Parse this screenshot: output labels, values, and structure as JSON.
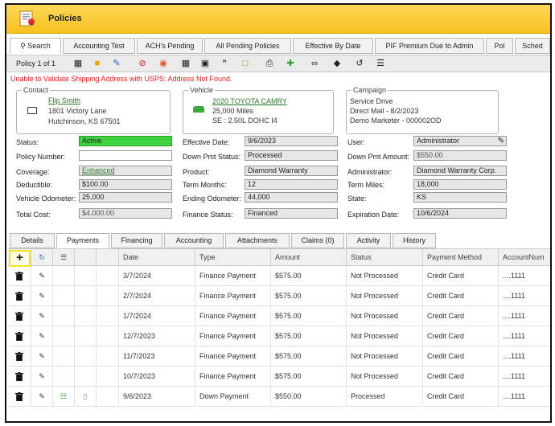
{
  "app": {
    "title": "Policies"
  },
  "top_tabs": [
    {
      "label": "Search",
      "icon": "search-icon"
    },
    {
      "label": "Accounting Test"
    },
    {
      "label": "ACH's Pending"
    },
    {
      "label": "All Pending Policies"
    },
    {
      "label": "Effective By Date"
    },
    {
      "label": "PIF Premium Due to Admin"
    },
    {
      "label": "Pol"
    },
    {
      "label": "Sched"
    }
  ],
  "toolbar": {
    "policy_count": "Policy 1 of 1",
    "icons": [
      "grid-icon",
      "folder-icon",
      "edit-doc-icon",
      "cancel-icon",
      "lifebuoy-icon",
      "calculator-icon",
      "trash-icon",
      "quote-icon",
      "document-icon",
      "printer-icon",
      "add-file-icon",
      "link-icon",
      "tag-icon",
      "history-icon",
      "list-icon"
    ]
  },
  "warning": "Unable to Validate Shipping Address with USPS: Address Not Found.",
  "contact": {
    "legend": "Contact",
    "name": "Flip Smith",
    "street": "1801 Victory Lane",
    "city": "Hutchinson, KS 67501"
  },
  "vehicle": {
    "legend": "Vehicle",
    "title": "2020 TOYOTA CAMRY",
    "miles": "25,000 Miles",
    "engine": "SE : 2.50L DOHC I4"
  },
  "campaign": {
    "legend": "Campaign",
    "name": "Service Drive",
    "mail": "Direct Mail - 8/2/2023",
    "marketer": "Demo Marketer - 000002OD"
  },
  "fields": {
    "status_label": "Status:",
    "status": "Active",
    "policy_number_label": "Policy Number:",
    "policy_number": "",
    "coverage_label": "Coverage:",
    "coverage": "Enhanced",
    "deductible_label": "Deductible:",
    "deductible": "$100.00",
    "vehicle_odometer_label": "Vehicle Odometer:",
    "vehicle_odometer": "25,000",
    "total_cost_label": "Total Cost:",
    "total_cost": "$4,000.00",
    "effective_date_label": "Effective Date:",
    "effective_date": "9/6/2023",
    "down_pmt_status_label": "Down Pmt Status:",
    "down_pmt_status": "Processed",
    "product_label": "Product:",
    "product": "Diamond Warranty",
    "term_months_label": "Term Months:",
    "term_months": "12",
    "ending_odometer_label": "Ending Odometer:",
    "ending_odometer": "44,000",
    "finance_status_label": "Finance Status:",
    "finance_status": "Financed",
    "user_label": "User:",
    "user": "Administrator",
    "down_pmt_amount_label": "Down Pmt Amount:",
    "down_pmt_amount": "$550.00",
    "administrator_label": "Administrator:",
    "administrator": "Diamond Warranty Corp.",
    "term_miles_label": "Term Miles:",
    "term_miles": "18,000",
    "state_label": "State:",
    "state": "KS",
    "expiration_date_label": "Expiration Date:",
    "expiration_date": "10/6/2024"
  },
  "sub_tabs": [
    "Details",
    "Payments",
    "Financing",
    "Accounting",
    "Attachments",
    "Claims (0)",
    "Activity",
    "History"
  ],
  "grid": {
    "add_label": "+",
    "columns": [
      "Date",
      "Type",
      "Amount",
      "Status",
      "Payment Method",
      "AccountNum"
    ],
    "rows": [
      {
        "date": "3/7/2024",
        "type": "Finance Payment",
        "amount": "$575.00",
        "status": "Not Processed",
        "method": "Credit Card",
        "account": "....1111"
      },
      {
        "date": "2/7/2024",
        "type": "Finance Payment",
        "amount": "$575.00",
        "status": "Not Processed",
        "method": "Credit Card",
        "account": "....1111"
      },
      {
        "date": "1/7/2024",
        "type": "Finance Payment",
        "amount": "$575.00",
        "status": "Not Processed",
        "method": "Credit Card",
        "account": "....1111"
      },
      {
        "date": "12/7/2023",
        "type": "Finance Payment",
        "amount": "$575.00",
        "status": "Not Processed",
        "method": "Credit Card",
        "account": "....1111"
      },
      {
        "date": "11/7/2023",
        "type": "Finance Payment",
        "amount": "$575.00",
        "status": "Not Processed",
        "method": "Credit Card",
        "account": "....1111"
      },
      {
        "date": "10/7/2023",
        "type": "Finance Payment",
        "amount": "$575.00",
        "status": "Not Processed",
        "method": "Credit Card",
        "account": "....1111"
      },
      {
        "date": "9/6/2023",
        "type": "Down Payment",
        "amount": "$550.00",
        "status": "Processed",
        "method": "Credit Card",
        "account": "....1111"
      }
    ]
  }
}
